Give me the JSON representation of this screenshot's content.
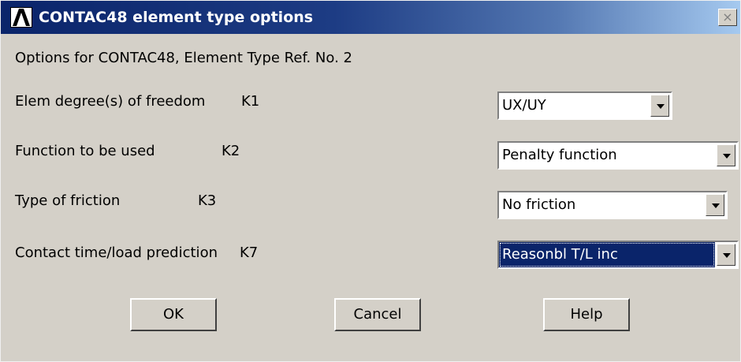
{
  "window": {
    "title": "CONTAC48 element type options",
    "close_glyph": "×",
    "logo_icon": "ansys-logo-icon"
  },
  "subtitle": "Options for CONTAC48, Element Type Ref. No. 2",
  "options": [
    {
      "label": "Elem degree(s) of freedom",
      "key": "K1",
      "value": "UX/UY"
    },
    {
      "label": "Function to be used",
      "key": "K2",
      "value": "Penalty function"
    },
    {
      "label": "Type of friction",
      "key": "K3",
      "value": "No friction"
    },
    {
      "label": "Contact time/load prediction",
      "key": "K7",
      "value": "Reasonbl T/L inc"
    }
  ],
  "buttons": {
    "ok": "OK",
    "cancel": "Cancel",
    "help": "Help"
  },
  "colors": {
    "titlebar_start": "#0a246a",
    "titlebar_end": "#a6caf0",
    "dialog_bg": "#d4d0c8",
    "highlight": "#0a246a"
  }
}
